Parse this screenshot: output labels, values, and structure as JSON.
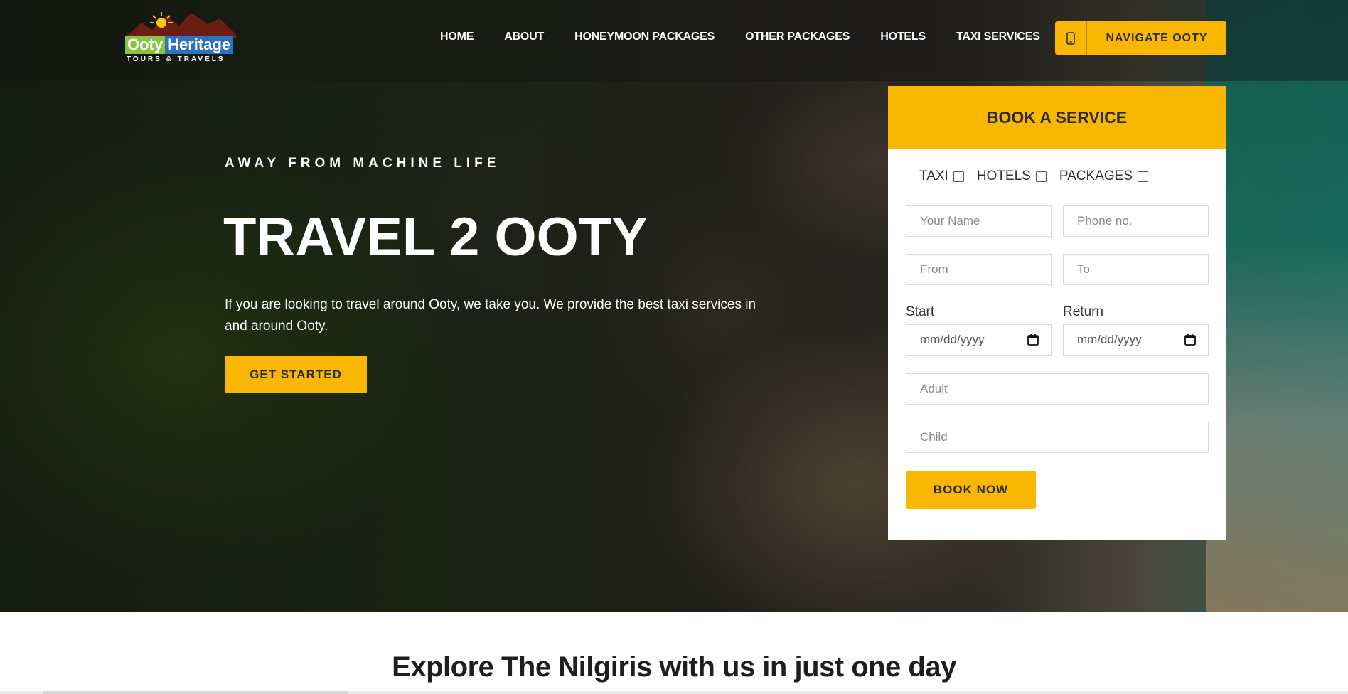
{
  "brand": {
    "logo_word_1": "Ooty",
    "logo_word_2": "Heritage",
    "logo_sub": "TOURS & TRAVELS"
  },
  "nav": {
    "items": [
      "HOME",
      "ABOUT",
      "HONEYMOON PACKAGES",
      "OTHER PACKAGES",
      "HOTELS",
      "TAXI SERVICES"
    ],
    "cta_label": "NAVIGATE OOTY",
    "cta_icon": "phone-icon"
  },
  "hero": {
    "tagline": "AWAY FROM MACHINE LIFE",
    "title": "TRAVEL 2 OOTY",
    "description": "If you are looking to travel around Ooty, we take you. We provide the best taxi services in and around Ooty.",
    "button_label": "GET STARTED"
  },
  "booking": {
    "title": "BOOK A SERVICE",
    "options": [
      "TAXI",
      "HOTELS",
      "PACKAGES"
    ],
    "name_placeholder": "Your Name",
    "phone_placeholder": "Phone no.",
    "from_placeholder": "From",
    "to_placeholder": "To",
    "start_label": "Start",
    "return_label": "Return",
    "start_value": "mm/dd/yyyy",
    "return_value": "mm/dd/yyyy",
    "adult_placeholder": "Adult",
    "child_placeholder": "Child",
    "submit_label": "BOOK NOW"
  },
  "section": {
    "title": "Explore The Nilgiris with us in just one day"
  },
  "colors": {
    "accent": "#f9b700",
    "dark_text": "#2b2b2b",
    "logo_green": "#8bc53f",
    "logo_blue": "#2a73c4"
  }
}
